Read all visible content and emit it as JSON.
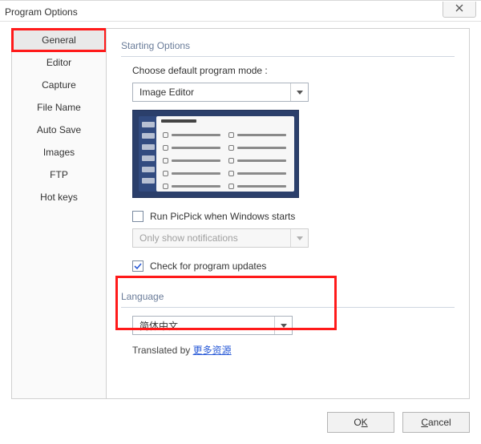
{
  "window": {
    "title": "Program Options"
  },
  "sidebar": {
    "items": [
      {
        "label": "General",
        "active": true
      },
      {
        "label": "Editor"
      },
      {
        "label": "Capture"
      },
      {
        "label": "File Name"
      },
      {
        "label": "Auto Save"
      },
      {
        "label": "Images"
      },
      {
        "label": "FTP"
      },
      {
        "label": "Hot keys"
      }
    ]
  },
  "starting": {
    "heading": "Starting Options",
    "mode_label": "Choose default program mode :",
    "mode_value": "Image Editor",
    "run_on_start_label": "Run PicPick when Windows starts",
    "run_on_start_checked": false,
    "notify_value": "Only show notifications",
    "updates_label": "Check for program updates",
    "updates_checked": true
  },
  "language": {
    "heading": "Language",
    "value": "简体中文",
    "translated_prefix": "Translated by ",
    "translated_link": "更多资源"
  },
  "buttons": {
    "ok_pre": "O",
    "ok_u": "K",
    "cancel_u": "C",
    "cancel_post": "ancel"
  }
}
